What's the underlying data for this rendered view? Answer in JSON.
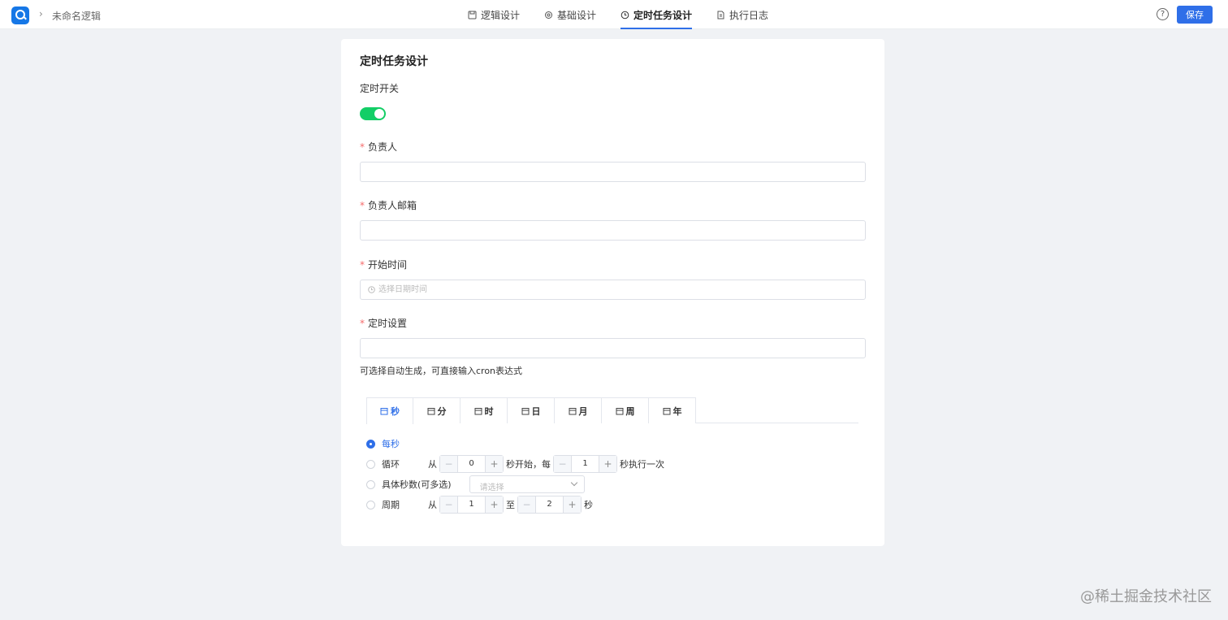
{
  "header": {
    "breadcrumb_title": "未命名逻辑",
    "tabs": [
      {
        "label": "逻辑设计",
        "icon": "save-icon"
      },
      {
        "label": "基础设计",
        "icon": "gear-icon"
      },
      {
        "label": "定时任务设计",
        "icon": "clock-icon",
        "active": true
      },
      {
        "label": "执行日志",
        "icon": "document-icon"
      }
    ],
    "help_glyph": "?",
    "save_label": "保存"
  },
  "form": {
    "title": "定时任务设计",
    "switch_label": "定时开关",
    "switch_on": true,
    "owner_label": "负责人",
    "owner_value": "",
    "email_label": "负责人邮箱",
    "email_value": "",
    "start_label": "开始时间",
    "start_placeholder": "选择日期时间",
    "cron_label": "定时设置",
    "cron_value": "",
    "cron_hint": "可选择自动生成，可直接输入cron表达式",
    "required_mark": "*"
  },
  "cron": {
    "tabs": [
      "秒",
      "分",
      "时",
      "日",
      "月",
      "周",
      "年"
    ],
    "active_tab": 0,
    "options": {
      "every": "每秒",
      "cycle": "循环",
      "specific": "具体秒数(可多选)",
      "period": "周期"
    },
    "cycle": {
      "from_text": "从",
      "start": "0",
      "mid_text": "秒开始，每",
      "every": "1",
      "end_text": "秒执行一次"
    },
    "specific_placeholder": "请选择",
    "period": {
      "from_text": "从",
      "start": "1",
      "to_text": "至",
      "end": "2",
      "unit": "秒"
    },
    "minus": "−",
    "plus": "+"
  },
  "watermark": "@稀土掘金技术社区",
  "colors": {
    "primary": "#2f6fe8",
    "switch_on": "#13ce66",
    "required": "#f56c6c"
  }
}
